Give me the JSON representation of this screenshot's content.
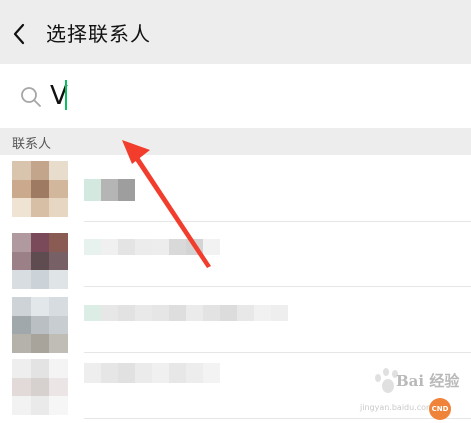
{
  "header": {
    "title": "选择联系人",
    "back_icon": "chevron-left-icon"
  },
  "search": {
    "value": "V",
    "icon": "search-icon",
    "caret_color": "#07c160"
  },
  "section": {
    "label": "联系人"
  },
  "contacts_count_visible": 4,
  "watermark": {
    "text": "Bai 经验",
    "sub": "jingyan.baidu.com"
  },
  "annotation": {
    "arrow_color": "#f23c2c"
  }
}
